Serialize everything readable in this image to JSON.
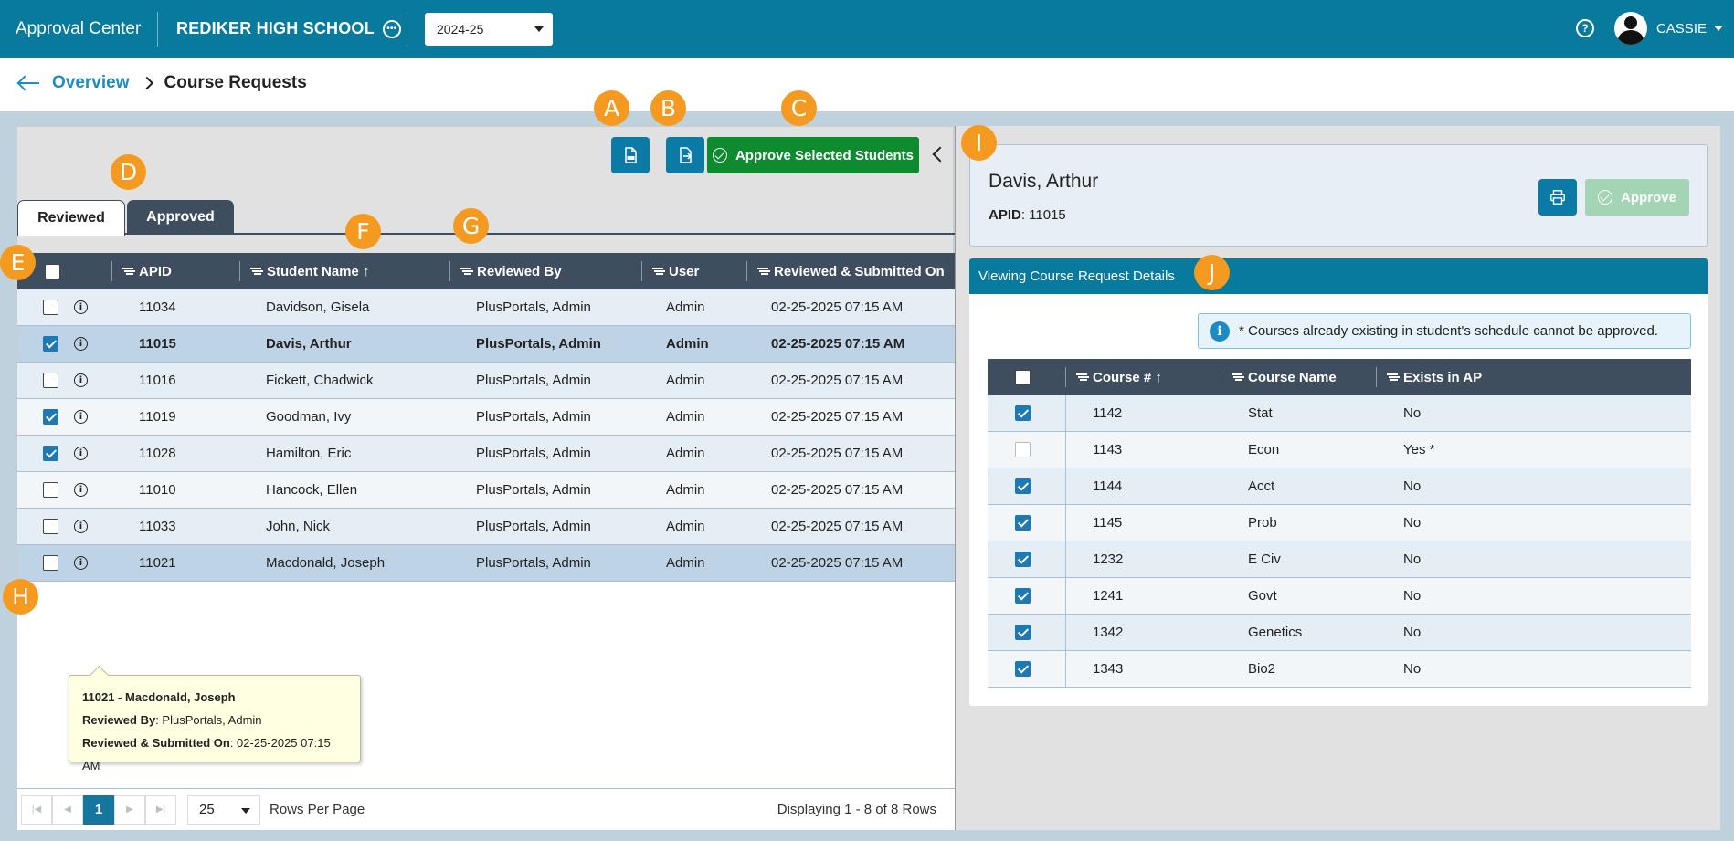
{
  "topbar": {
    "app_title": "Approval Center",
    "school_name": "REDIKER HIGH SCHOOL",
    "school_year": "2024-25",
    "help_label": "?",
    "user_name": "CASSIE"
  },
  "breadcrumb": {
    "parent": "Overview",
    "current": "Course Requests"
  },
  "toolbar": {
    "approve_selected_label": "Approve Selected Students"
  },
  "markers": {
    "a": "A",
    "b": "B",
    "c": "C",
    "d": "D",
    "e": "E",
    "f": "F",
    "g": "G",
    "h": "H",
    "i": "I",
    "j": "J"
  },
  "tabs": [
    {
      "label": "Reviewed",
      "active": true
    },
    {
      "label": "Approved",
      "active": false
    }
  ],
  "student_grid": {
    "columns": {
      "apid": "APID",
      "student_name": "Student Name",
      "sort_indicator": "↑",
      "reviewed_by": "Reviewed By",
      "user": "User",
      "reviewed_submitted_on": "Reviewed & Submitted On"
    },
    "rows": [
      {
        "checked": false,
        "apid": "11034",
        "name": "Davidson, Gisela",
        "reviewed_by": "PlusPortals, Admin",
        "user": "Admin",
        "submitted_on": "02-25-2025 07:15 AM"
      },
      {
        "checked": true,
        "apid": "11015",
        "name": "Davis, Arthur",
        "reviewed_by": "PlusPortals, Admin",
        "user": "Admin",
        "submitted_on": "02-25-2025 07:15 AM"
      },
      {
        "checked": false,
        "apid": "11016",
        "name": "Fickett, Chadwick",
        "reviewed_by": "PlusPortals, Admin",
        "user": "Admin",
        "submitted_on": "02-25-2025 07:15 AM"
      },
      {
        "checked": true,
        "apid": "11019",
        "name": "Goodman, Ivy",
        "reviewed_by": "PlusPortals, Admin",
        "user": "Admin",
        "submitted_on": "02-25-2025 07:15 AM"
      },
      {
        "checked": true,
        "apid": "11028",
        "name": "Hamilton, Eric",
        "reviewed_by": "PlusPortals, Admin",
        "user": "Admin",
        "submitted_on": "02-25-2025 07:15 AM"
      },
      {
        "checked": false,
        "apid": "11010",
        "name": "Hancock, Ellen",
        "reviewed_by": "PlusPortals, Admin",
        "user": "Admin",
        "submitted_on": "02-25-2025 07:15 AM"
      },
      {
        "checked": false,
        "apid": "11033",
        "name": "John, Nick",
        "reviewed_by": "PlusPortals, Admin",
        "user": "Admin",
        "submitted_on": "02-25-2025 07:15 AM"
      },
      {
        "checked": false,
        "apid": "11021",
        "name": "Macdonald, Joseph",
        "reviewed_by": "PlusPortals, Admin",
        "user": "Admin",
        "submitted_on": "02-25-2025 07:15 AM"
      }
    ]
  },
  "tooltip": {
    "title": "11021 - Macdonald, Joseph",
    "reviewed_by_label": "Reviewed By",
    "reviewed_by_value": ": PlusPortals, Admin",
    "submitted_label": "Reviewed & Submitted On",
    "submitted_value": ": 02-25-2025 07:15 AM"
  },
  "pager": {
    "current_page": "1",
    "page_size": "25",
    "rows_per_page_label": "Rows Per Page",
    "display_text": "Displaying 1 - 8 of 8 Rows"
  },
  "student_detail": {
    "name": "Davis, Arthur",
    "apid_label": "APID",
    "apid_value": ": 11015",
    "approve_label": "Approve"
  },
  "course_details": {
    "header": "Viewing Course Request Details",
    "notice": "* Courses already existing in student's schedule cannot be approved.",
    "columns": {
      "course_num": "Course #",
      "sort_indicator": "↑",
      "course_name": "Course Name",
      "exists_in_ap": "Exists in AP"
    },
    "rows": [
      {
        "checked": true,
        "num": "1142",
        "name": "Stat",
        "exists": "No"
      },
      {
        "checked": false,
        "num": "1143",
        "name": "Econ",
        "exists": "Yes *"
      },
      {
        "checked": true,
        "num": "1144",
        "name": "Acct",
        "exists": "No"
      },
      {
        "checked": true,
        "num": "1145",
        "name": "Prob",
        "exists": "No"
      },
      {
        "checked": true,
        "num": "1232",
        "name": "E Civ",
        "exists": "No"
      },
      {
        "checked": true,
        "num": "1241",
        "name": "Govt",
        "exists": "No"
      },
      {
        "checked": true,
        "num": "1342",
        "name": "Genetics",
        "exists": "No"
      },
      {
        "checked": true,
        "num": "1343",
        "name": "Bio2",
        "exists": "No"
      }
    ]
  },
  "colors": {
    "header_teal": "#077a9e",
    "approve_green": "#0e8a2f",
    "marker_orange": "#f59a20",
    "grid_header": "#3f4e5e"
  }
}
